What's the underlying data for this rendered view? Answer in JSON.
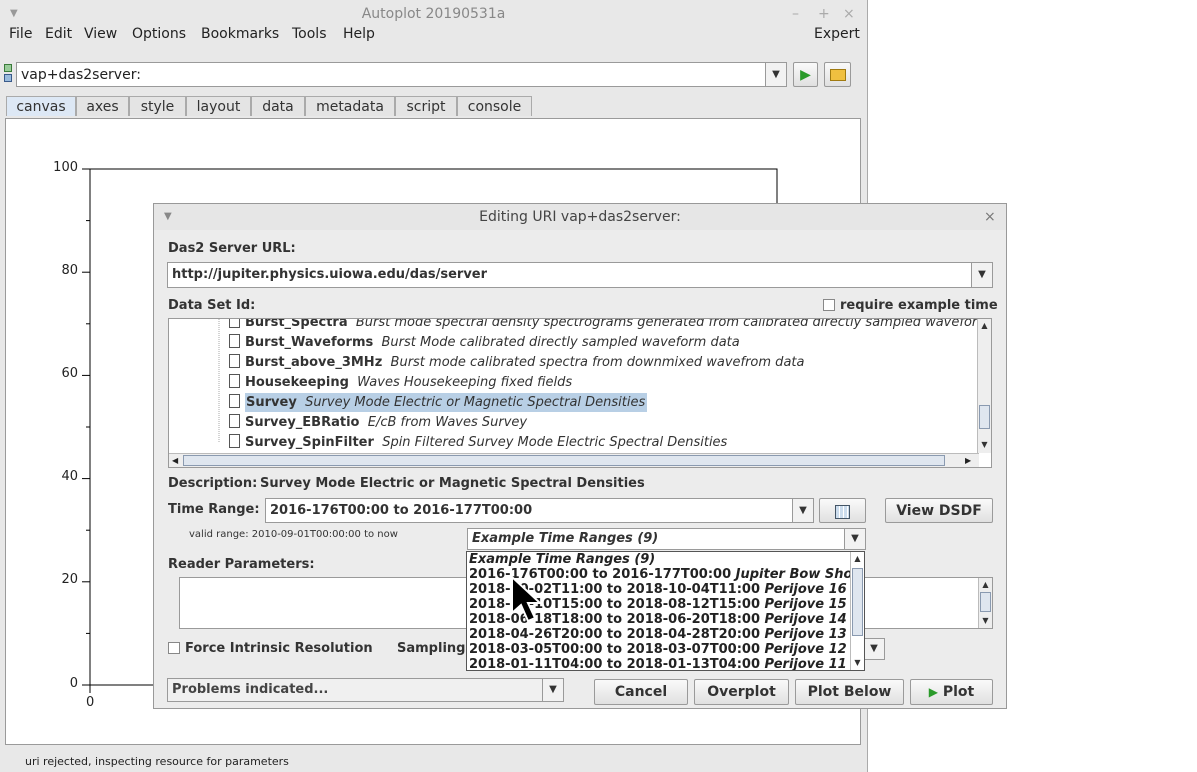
{
  "window": {
    "title": "Autoplot 20190531a",
    "controls": [
      "–",
      "+",
      "×"
    ]
  },
  "menu": {
    "items": [
      "File",
      "Edit",
      "View",
      "Options",
      "Bookmarks",
      "Tools",
      "Help"
    ],
    "expert": "Expert"
  },
  "uri_bar": {
    "value": "vap+das2server:"
  },
  "tabs": [
    "canvas",
    "axes",
    "style",
    "layout",
    "data",
    "metadata",
    "script",
    "console"
  ],
  "active_tab": "canvas",
  "plot": {
    "yticks": [
      "100",
      "80",
      "60",
      "40",
      "20",
      "0"
    ],
    "xtick": "0"
  },
  "status": "uri rejected, inspecting resource for parameters",
  "dialog": {
    "title": "Editing URI vap+das2server:",
    "server_label": "Das2 Server URL:",
    "server_url": "http://jupiter.physics.uiowa.edu/das/server",
    "dataset_label": "Data Set Id:",
    "require_example": "require example time",
    "datasets": [
      {
        "name": "Burst_Spectra",
        "desc": "Burst mode spectral density spectrograms generated from calibrated directly sampled waveform data"
      },
      {
        "name": "Burst_Waveforms",
        "desc": "Burst Mode calibrated directly sampled waveform data"
      },
      {
        "name": "Burst_above_3MHz",
        "desc": "Burst mode calibrated spectra from downmixed wavefrom data"
      },
      {
        "name": "Housekeeping",
        "desc": "Waves Housekeeping fixed fields"
      },
      {
        "name": "Survey",
        "desc": "Survey Mode Electric or Magnetic Spectral Densities"
      },
      {
        "name": "Survey_EBRatio",
        "desc": "E/cB from Waves Survey"
      },
      {
        "name": "Survey_SpinFilter",
        "desc": "Spin Filtered Survey Mode Electric Spectral Densities"
      }
    ],
    "selected_dataset": "Survey",
    "description_label": "Description:",
    "description": "Survey Mode Electric or Magnetic Spectral Densities",
    "time_range_label": "Time Range:",
    "time_range": "2016-176T00:00 to 2016-177T00:00",
    "view_dsdf": "View DSDF",
    "valid_range": "valid range: 2010-09-01T00:00:00 to now",
    "example_combo": "Example Time Ranges (9)",
    "reader_params_label": "Reader Parameters:",
    "force_intrinsic": "Force Intrinsic Resolution",
    "sampling_label": "Sampling",
    "problems": "Problems indicated...",
    "buttons": {
      "cancel": "Cancel",
      "overplot": "Overplot",
      "plot_below": "Plot Below",
      "plot": "Plot"
    }
  },
  "example_popup": {
    "header": "Example Time Ranges (9)",
    "items": [
      {
        "range": "2016-176T00:00 to 2016-177T00:00",
        "label": "Jupiter Bow Shock, M"
      },
      {
        "range": "2018-10-02T11:00 to 2018-10-04T11:00",
        "label": "Perijove 16"
      },
      {
        "range": "2018-08-10T15:00 to 2018-08-12T15:00",
        "label": "Perijove 15"
      },
      {
        "range": "2018-06-18T18:00 to 2018-06-20T18:00",
        "label": "Perijove 14"
      },
      {
        "range": "2018-04-26T20:00 to 2018-04-28T20:00",
        "label": "Perijove 13"
      },
      {
        "range": "2018-03-05T00:00 to 2018-03-07T00:00",
        "label": "Perijove 12"
      },
      {
        "range": "2018-01-11T04:00 to 2018-01-13T04:00",
        "label": "Perijove 11"
      }
    ]
  }
}
